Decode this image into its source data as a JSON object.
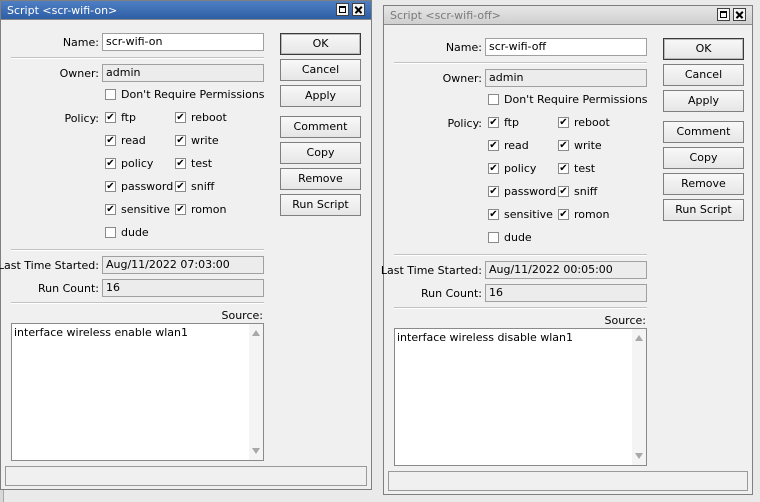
{
  "windows": [
    {
      "title": "Script <scr-wifi-on>",
      "name_label": "Name:",
      "name_value": "scr-wifi-on",
      "owner_label": "Owner:",
      "owner_value": "admin",
      "dont_require_label": "Don't Require Permissions",
      "dont_require_checked": false,
      "policy_label": "Policy:",
      "policies": [
        {
          "label": "ftp",
          "checked": true
        },
        {
          "label": "reboot",
          "checked": true
        },
        {
          "label": "read",
          "checked": true
        },
        {
          "label": "write",
          "checked": true
        },
        {
          "label": "policy",
          "checked": true
        },
        {
          "label": "test",
          "checked": true
        },
        {
          "label": "password",
          "checked": true
        },
        {
          "label": "sniff",
          "checked": true
        },
        {
          "label": "sensitive",
          "checked": true
        },
        {
          "label": "romon",
          "checked": true
        },
        {
          "label": "dude",
          "checked": false
        }
      ],
      "last_started_label": "Last Time Started:",
      "last_started_value": "Aug/11/2022 07:03:00",
      "run_count_label": "Run Count:",
      "run_count_value": "16",
      "source_label": "Source:",
      "source_value": "interface wireless enable wlan1",
      "buttons": [
        "OK",
        "Cancel",
        "Apply",
        "Comment",
        "Copy",
        "Remove",
        "Run Script"
      ],
      "active": true
    },
    {
      "title": "Script <scr-wifi-off>",
      "name_label": "Name:",
      "name_value": "scr-wifi-off",
      "owner_label": "Owner:",
      "owner_value": "admin",
      "dont_require_label": "Don't Require Permissions",
      "dont_require_checked": false,
      "policy_label": "Policy:",
      "policies": [
        {
          "label": "ftp",
          "checked": true
        },
        {
          "label": "reboot",
          "checked": true
        },
        {
          "label": "read",
          "checked": true
        },
        {
          "label": "write",
          "checked": true
        },
        {
          "label": "policy",
          "checked": true
        },
        {
          "label": "test",
          "checked": true
        },
        {
          "label": "password",
          "checked": true
        },
        {
          "label": "sniff",
          "checked": true
        },
        {
          "label": "sensitive",
          "checked": true
        },
        {
          "label": "romon",
          "checked": true
        },
        {
          "label": "dude",
          "checked": false
        }
      ],
      "last_started_label": "Last Time Started:",
      "last_started_value": "Aug/11/2022 00:05:00",
      "run_count_label": "Run Count:",
      "run_count_value": "16",
      "source_label": "Source:",
      "source_value": "interface wireless disable wlan1",
      "buttons": [
        "OK",
        "Cancel",
        "Apply",
        "Comment",
        "Copy",
        "Remove",
        "Run Script"
      ],
      "active": false
    }
  ],
  "check_glyph": "✔",
  "icons": {
    "maximize": "maximize-icon",
    "close": "close-icon",
    "scroll_up": "scroll-up-icon",
    "scroll_down": "scroll-down-icon"
  }
}
